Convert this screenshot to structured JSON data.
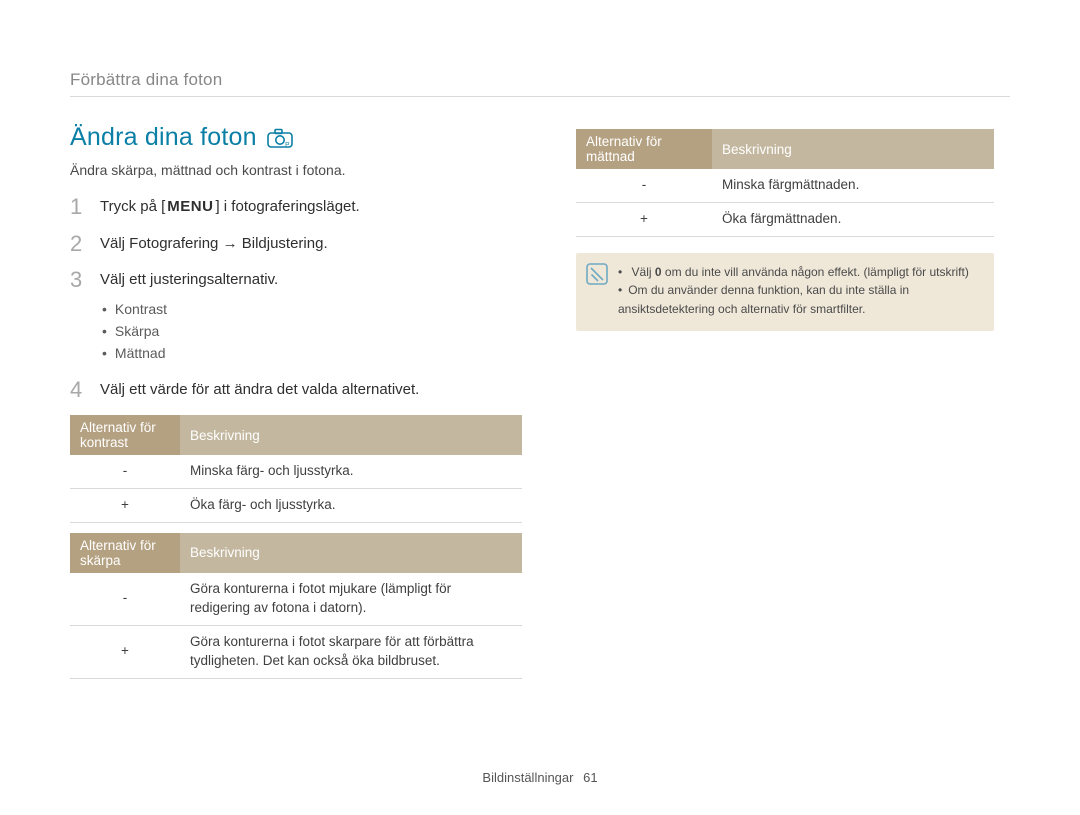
{
  "breadcrumb": "Förbättra dina foton",
  "title": "Ändra dina foton",
  "camera_icon_name": "camera-icon",
  "subtitle": "Ändra skärpa, mättnad och kontrast i fotona.",
  "steps": [
    {
      "num": "1",
      "before": "Tryck på [",
      "menu": "MENU",
      "after": "] i fotograferingsläget."
    },
    {
      "num": "2",
      "text": "Välj Fotografering → Bildjustering."
    },
    {
      "num": "3",
      "text": "Välj ett justeringsalternativ.",
      "bullets": [
        "Kontrast",
        "Skärpa",
        "Mättnad"
      ]
    },
    {
      "num": "4",
      "text": "Välj ett värde för att ändra det valda alternativet."
    }
  ],
  "tables": {
    "contrast": {
      "head_a": "Alternativ för kontrast",
      "head_b": "Beskrivning",
      "rows": [
        {
          "a": "-",
          "b": "Minska färg- och ljusstyrka."
        },
        {
          "a": "+",
          "b": "Öka färg- och ljusstyrka."
        }
      ]
    },
    "sharpness": {
      "head_a": "Alternativ för skärpa",
      "head_b": "Beskrivning",
      "rows": [
        {
          "a": "-",
          "b": "Göra konturerna i fotot mjukare (lämpligt för redigering av fotona i datorn)."
        },
        {
          "a": "+",
          "b": "Göra konturerna i fotot skarpare för att förbättra tydligheten. Det kan också öka bildbruset."
        }
      ]
    },
    "saturation": {
      "head_a": "Alternativ för mättnad",
      "head_b": "Beskrivning",
      "rows": [
        {
          "a": "-",
          "b": "Minska färgmättnaden."
        },
        {
          "a": "+",
          "b": "Öka färgmättnaden."
        }
      ]
    }
  },
  "note": {
    "items": [
      {
        "before": "Välj ",
        "bold": "0",
        "after": " om du inte vill använda någon effekt. (lämpligt för utskrift)"
      },
      {
        "text": "Om du använder denna funktion, kan du inte ställa in ansiktsdetektering och alternativ för smartfilter."
      }
    ]
  },
  "footer": {
    "section": "Bildinställningar",
    "page": "61"
  }
}
